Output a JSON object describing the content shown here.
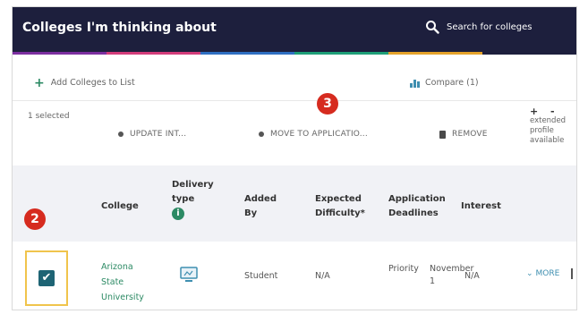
{
  "header": {
    "title": "Colleges I'm thinking about",
    "search_label": "Search for colleges",
    "accent_colors": [
      "#7c2fa0",
      "#d23c7a",
      "#2f6fc2",
      "#1e9f78",
      "#e4a22a",
      "#1d1f3d"
    ]
  },
  "toolbar": {
    "add_label": "Add Colleges to List",
    "compare_label": "Compare (1)",
    "selected_label": "1 selected",
    "update_label": "UPDATE INT...",
    "move_label": "MOVE TO APPLICATIO...",
    "remove_label": "REMOVE",
    "extended_icons": "+ -",
    "extended_label": "extended profile available"
  },
  "markers": {
    "step2": "2",
    "step3": "3"
  },
  "table": {
    "headers": {
      "college": "College",
      "delivery": "Delivery type",
      "added_by": "Added By",
      "expected": "Expected Difficulty*",
      "deadlines": "Application Deadlines",
      "interest": "Interest"
    },
    "info_icon": "i",
    "row": {
      "college": "Arizona State University",
      "added_by": "Student",
      "expected": "N/A",
      "deadline_type": "Priority",
      "deadline_date": "November 1",
      "interest": "N/A",
      "more_label": "MORE",
      "checked": true
    }
  },
  "colors": {
    "header_bg": "#1d1f3d",
    "accent_green": "#2c8a64",
    "marker_red": "#d62b1f",
    "highlight_yellow": "#f0c44c",
    "checkbox_teal": "#1e6474"
  }
}
